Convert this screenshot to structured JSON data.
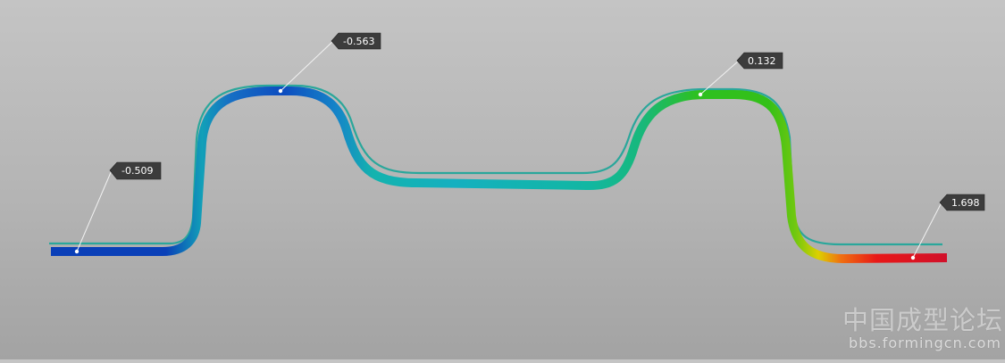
{
  "probes": [
    {
      "id": "left-flange",
      "value": "-0.509"
    },
    {
      "id": "left-crown",
      "value": "-0.563"
    },
    {
      "id": "right-crown",
      "value": "0.132"
    },
    {
      "id": "right-flange",
      "value": "1.698"
    }
  ],
  "colors": {
    "outline": "#2aa79b",
    "tag_fill": "#3c3c3c",
    "tag_text": "#ffffff",
    "scale": [
      "#0a3fb8",
      "#1180c8",
      "#12b3b8",
      "#15b870",
      "#2cc01e",
      "#7ccb10",
      "#e0d000",
      "#f07a10",
      "#e81010",
      "#d0102a"
    ]
  },
  "watermark": {
    "site_name": "中国成型论坛",
    "url": "bbs.formingcn.com"
  }
}
